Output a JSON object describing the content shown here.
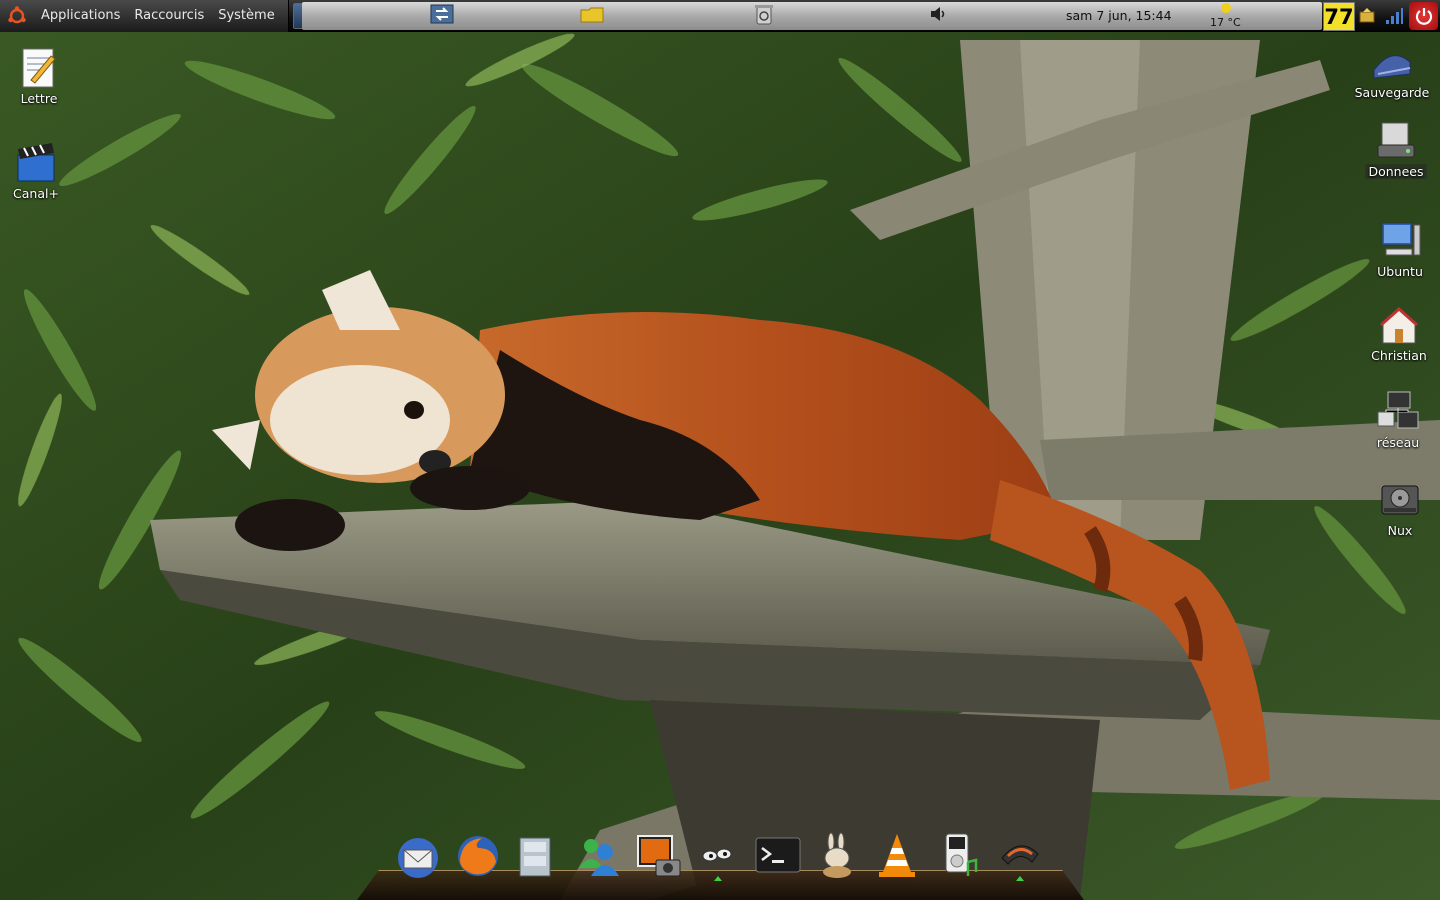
{
  "top_panel": {
    "menus": [
      {
        "label": "Applications"
      },
      {
        "label": "Raccourcis"
      },
      {
        "label": "Système"
      }
    ],
    "clock": "sam  7 jun, 15:44",
    "weather": {
      "temperature": "17 °C",
      "icon": "sun-icon"
    },
    "tray_badge": "77",
    "task_icons": [
      "window-switch-icon",
      "folder-icon",
      "trash-icon"
    ],
    "tray_icons": [
      "volume-icon",
      "update-icon",
      "network-signal-icon",
      "power-icon"
    ]
  },
  "desktop_icons_left": [
    {
      "label": "Lettre",
      "icon": "text-document-icon"
    },
    {
      "label": "Canal+",
      "icon": "video-clapper-icon"
    }
  ],
  "desktop_icons_right": [
    {
      "label": "Sauvegarde",
      "icon": "backup-drive-icon"
    },
    {
      "label": "Donnees",
      "icon": "data-drive-icon"
    },
    {
      "label": "Ubuntu",
      "icon": "computer-icon"
    },
    {
      "label": "Christian",
      "icon": "home-folder-icon"
    },
    {
      "label": "réseau",
      "icon": "network-icon"
    },
    {
      "label": "Nux",
      "icon": "hard-disk-icon"
    }
  ],
  "dock": {
    "items": [
      {
        "name": "thunderbird",
        "icon": "mail-client-icon",
        "running": false
      },
      {
        "name": "firefox",
        "icon": "web-browser-icon",
        "running": false
      },
      {
        "name": "file-manager",
        "icon": "file-cabinet-icon",
        "running": false
      },
      {
        "name": "messenger",
        "icon": "instant-messenger-icon",
        "running": false
      },
      {
        "name": "photo-viewer",
        "icon": "photo-camera-icon",
        "running": false
      },
      {
        "name": "pidgin",
        "icon": "chat-eyes-icon",
        "running": true
      },
      {
        "name": "terminal",
        "icon": "terminal-icon",
        "running": false
      },
      {
        "name": "rabbit-app",
        "icon": "rabbit-icon",
        "running": false
      },
      {
        "name": "vlc",
        "icon": "vlc-cone-icon",
        "running": false
      },
      {
        "name": "music-player",
        "icon": "music-player-icon",
        "running": false
      },
      {
        "name": "dock-settings",
        "icon": "dock-settings-icon",
        "running": true
      }
    ]
  },
  "colors": {
    "panel_bg": "#111111",
    "panel_text": "#e6e6e6",
    "badge_yellow": "#f3e02a",
    "power_red": "#d02020",
    "running_indicator": "#3fd33f"
  }
}
